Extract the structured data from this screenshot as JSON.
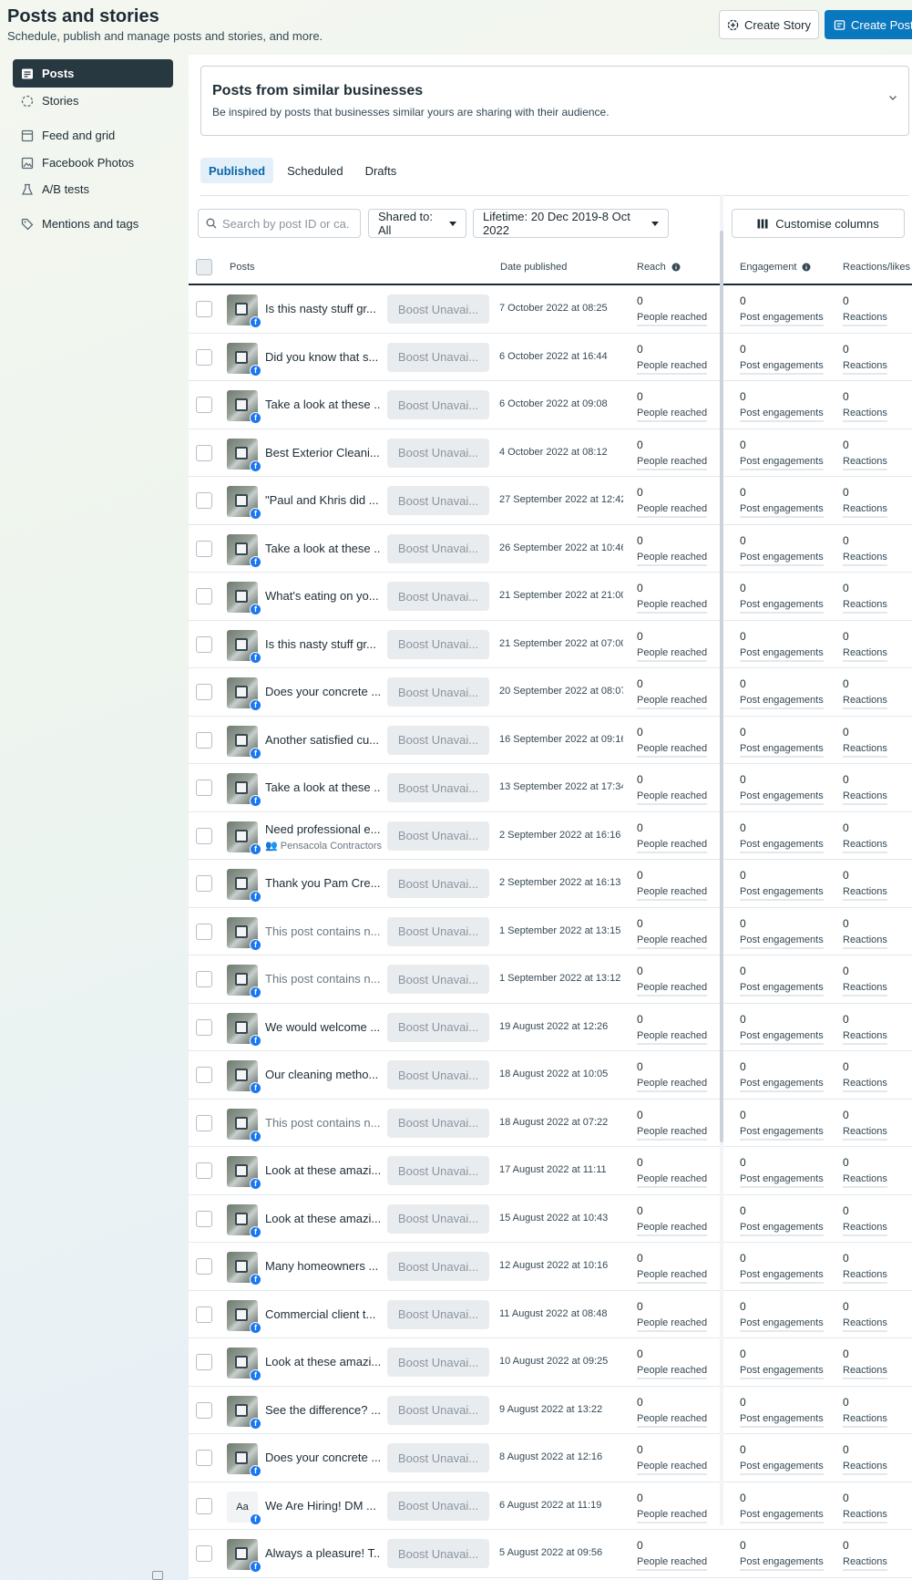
{
  "header": {
    "title": "Posts and stories",
    "subtitle": "Schedule, publish and manage posts and stories, and more.",
    "create_story": "Create Story",
    "create_post": "Create Post"
  },
  "sidebar": {
    "items": [
      {
        "label": "Posts",
        "icon": "posts-icon",
        "active": true
      },
      {
        "label": "Stories",
        "icon": "stories-icon",
        "active": false
      },
      {
        "label": "Feed and grid",
        "icon": "feed-grid-icon",
        "active": false
      },
      {
        "label": "Facebook Photos",
        "icon": "photos-icon",
        "active": false
      },
      {
        "label": "A/B tests",
        "icon": "flask-icon",
        "active": false
      },
      {
        "label": "Mentions and tags",
        "icon": "tag-icon",
        "active": false
      }
    ]
  },
  "similar": {
    "title": "Posts from similar businesses",
    "description": "Be inspired by posts that businesses similar yours are sharing with their audience."
  },
  "tabs": [
    "Published",
    "Scheduled",
    "Drafts"
  ],
  "filters": {
    "search_placeholder": "Search by post ID or ca...",
    "shared_to": "Shared to: All",
    "lifetime": "Lifetime: 20 Dec 2019-8 Oct 2022",
    "customise": "Customise columns"
  },
  "table": {
    "headers": {
      "posts": "Posts",
      "date": "Date published",
      "reach": "Reach",
      "engagement": "Engagement",
      "reactions": "Reactions/likes"
    },
    "boost_label": "Boost Unavai...",
    "metric_labels": {
      "reach": "People reached",
      "engagement": "Post engagements",
      "reactions": "Reactions"
    },
    "rows": [
      {
        "text": "Is this nasty stuff gr...",
        "date": "7 October 2022 at 08:25",
        "reach": "0",
        "engagement": "0",
        "reactions": "0"
      },
      {
        "text": "Did you know that s...",
        "date": "6 October 2022 at 16:44",
        "reach": "0",
        "engagement": "0",
        "reactions": "0"
      },
      {
        "text": "Take a look at these ...",
        "date": "6 October 2022 at 09:08",
        "reach": "0",
        "engagement": "0",
        "reactions": "0"
      },
      {
        "text": "Best Exterior Cleani...",
        "date": "4 October 2022 at 08:12",
        "reach": "0",
        "engagement": "0",
        "reactions": "0"
      },
      {
        "text": "\"Paul and Khris did ...",
        "date": "27 September 2022 at 12:42",
        "reach": "0",
        "engagement": "0",
        "reactions": "0"
      },
      {
        "text": "Take a look at these ...",
        "date": "26 September 2022 at 10:46",
        "reach": "0",
        "engagement": "0",
        "reactions": "0"
      },
      {
        "text": "What's eating on yo...",
        "date": "21 September 2022 at 21:00",
        "reach": "0",
        "engagement": "0",
        "reactions": "0"
      },
      {
        "text": "Is this nasty stuff gr...",
        "date": "21 September 2022 at 07:00",
        "reach": "0",
        "engagement": "0",
        "reactions": "0"
      },
      {
        "text": "Does your concrete ...",
        "date": "20 September 2022 at 08:07",
        "reach": "0",
        "engagement": "0",
        "reactions": "0"
      },
      {
        "text": "Another satisfied cu...",
        "date": "16 September 2022 at 09:16",
        "reach": "0",
        "engagement": "0",
        "reactions": "0"
      },
      {
        "text": "Take a look at these ...",
        "date": "13 September 2022 at 17:34",
        "reach": "0",
        "engagement": "0",
        "reactions": "0"
      },
      {
        "text": "Need professional e...",
        "sub": "Pensacola Contractors",
        "date": "2 September 2022 at 16:16",
        "reach": "0",
        "engagement": "0",
        "reactions": "0"
      },
      {
        "text": "Thank you Pam Cre...",
        "date": "2 September 2022 at 16:13",
        "reach": "0",
        "engagement": "0",
        "reactions": "0"
      },
      {
        "text": "This post contains n...",
        "muted": true,
        "date": "1 September 2022 at 13:15",
        "reach": "0",
        "engagement": "0",
        "reactions": "0"
      },
      {
        "text": "This post contains n...",
        "muted": true,
        "date": "1 September 2022 at 13:12",
        "reach": "0",
        "engagement": "0",
        "reactions": "0"
      },
      {
        "text": "We would welcome ...",
        "date": "19 August 2022 at 12:26",
        "reach": "0",
        "engagement": "0",
        "reactions": "0"
      },
      {
        "text": "Our cleaning metho...",
        "date": "18 August 2022 at 10:05",
        "reach": "0",
        "engagement": "0",
        "reactions": "0"
      },
      {
        "text": "This post contains n...",
        "muted": true,
        "date": "18 August 2022 at 07:22",
        "reach": "0",
        "engagement": "0",
        "reactions": "0"
      },
      {
        "text": "Look at these amazi...",
        "date": "17 August 2022 at 11:11",
        "reach": "0",
        "engagement": "0",
        "reactions": "0"
      },
      {
        "text": "Look at these amazi...",
        "date": "15 August 2022 at 10:43",
        "reach": "0",
        "engagement": "0",
        "reactions": "0"
      },
      {
        "text": "Many homeowners ...",
        "date": "12 August 2022 at 10:16",
        "reach": "0",
        "engagement": "0",
        "reactions": "0"
      },
      {
        "text": "Commercial client t...",
        "date": "11 August 2022 at 08:48",
        "reach": "0",
        "engagement": "0",
        "reactions": "0"
      },
      {
        "text": "Look at these amazi...",
        "date": "10 August 2022 at 09:25",
        "reach": "0",
        "engagement": "0",
        "reactions": "0"
      },
      {
        "text": "See the difference? ...",
        "date": "9 August 2022 at 13:22",
        "reach": "0",
        "engagement": "0",
        "reactions": "0"
      },
      {
        "text": "Does your concrete ...",
        "date": "8 August 2022 at 12:16",
        "reach": "0",
        "engagement": "0",
        "reactions": "0"
      },
      {
        "text": "We Are Hiring! DM ...",
        "thumb": "Aa",
        "date": "6 August 2022 at 11:19",
        "reach": "0",
        "engagement": "0",
        "reactions": "0"
      },
      {
        "text": "Always a pleasure! T...",
        "date": "5 August 2022 at 09:56",
        "reach": "0",
        "engagement": "0",
        "reactions": "0"
      }
    ]
  },
  "colors": {
    "accent": "#0a78be",
    "sidebar_active": "#283840",
    "tab_active_bg": "#e3f0fa",
    "facebook": "#1877f2"
  }
}
